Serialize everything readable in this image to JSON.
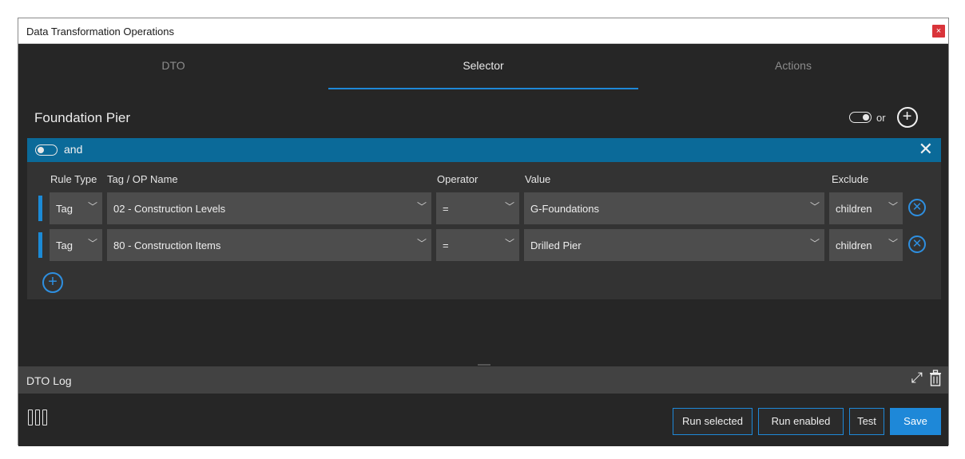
{
  "window": {
    "title": "Data Transformation Operations",
    "close_glyph": "×"
  },
  "tabs": [
    {
      "label": "DTO",
      "active": false
    },
    {
      "label": "Selector",
      "active": true
    },
    {
      "label": "Actions",
      "active": false
    }
  ],
  "selector": {
    "name": "Foundation Pier",
    "combinator_label": "or",
    "add_glyph": "+"
  },
  "group": {
    "label": "and",
    "close_glyph": "✕",
    "columns": {
      "rule_type": "Rule Type",
      "tag_name": "Tag / OP Name",
      "operator": "Operator",
      "value": "Value",
      "exclude": "Exclude"
    },
    "rows": [
      {
        "rule_type": "Tag",
        "tag_name": "02 - Construction Levels",
        "operator": "=",
        "value": "G-Foundations",
        "exclude": "children"
      },
      {
        "rule_type": "Tag",
        "tag_name": "80 - Construction Items",
        "operator": "=",
        "value": "Drilled Pier",
        "exclude": "children"
      }
    ],
    "remove_glyph": "✕",
    "add_glyph": "+"
  },
  "log": {
    "label": "DTO Log",
    "expand_glyph": "⤢"
  },
  "footer": {
    "run_selected": "Run selected",
    "run_enabled": "Run enabled",
    "test": "Test",
    "save": "Save"
  },
  "colors": {
    "accent": "#1e88d8",
    "group_header": "#0b6a99",
    "close": "#d9343a"
  },
  "icons": [
    "close-icon",
    "toggle-icon",
    "add-circle-icon",
    "remove-circle-icon",
    "chevron-down-icon",
    "expand-icon",
    "trash-icon",
    "columns-icon"
  ]
}
